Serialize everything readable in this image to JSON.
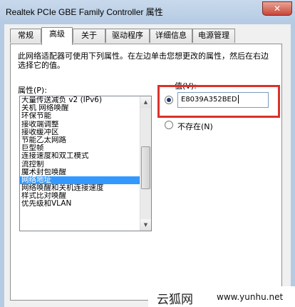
{
  "window": {
    "title": "Realtek PCIe GBE Family Controller 属性",
    "close_glyph": "✕"
  },
  "tabs": [
    {
      "label": "常规",
      "active": false
    },
    {
      "label": "高级",
      "active": true
    },
    {
      "label": "关于",
      "active": false
    },
    {
      "label": "驱动程序",
      "active": false
    },
    {
      "label": "详细信息",
      "active": false
    },
    {
      "label": "电源管理",
      "active": false
    }
  ],
  "advanced": {
    "description": "此网络适配器可使用下列属性。在左边单击您想更改的属性，然后在右边选择它的值。",
    "property_label": "属性(P):",
    "properties": [
      "大量传送减负 v2 (IPv6)",
      "关机 网络唤醒",
      "环保节能",
      "接收端调整",
      "接收缓冲区",
      "节能乙太网路",
      "巨型帧",
      "连接速度和双工模式",
      "流控制",
      "魔术封包唤醒",
      "网络地址",
      "网络唤醒和关机连接速度",
      "样式比对唤醒",
      "优先级和VLAN"
    ],
    "selected_index": 10,
    "value_label": "值(V):",
    "value": "E8039A352BED",
    "not_present_label": "不存在(N)",
    "value_radio_checked": true
  },
  "watermark": {
    "text": "云狐网",
    "url": "www.yunhu.net"
  },
  "colors": {
    "highlight": "#d9322c",
    "selection": "#3399ff"
  }
}
